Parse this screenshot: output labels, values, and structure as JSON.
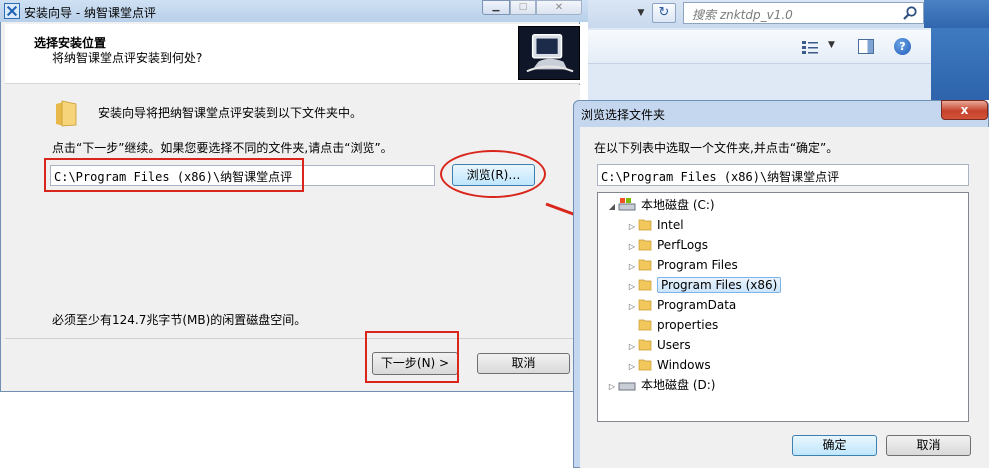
{
  "explorer": {
    "search_placeholder": "搜索 znktdp_v1.0",
    "icons": [
      "chevron-down-icon",
      "refresh-icon",
      "search-icon",
      "view-options-icon",
      "preview-pane-icon",
      "help-icon"
    ]
  },
  "installer": {
    "title": "安装向导 - 纳智课堂点评",
    "header_title": "选择安装位置",
    "header_subtitle": "将纳智课堂点评安装到何处?",
    "intro": "安装向导将把纳智课堂点评安装到以下文件夹中。",
    "instruction": "点击“下一步”继续。如果您要选择不同的文件夹,请点击“浏览”。",
    "path_value": "C:\\Program Files (x86)\\纳智课堂点评",
    "browse_label": "浏览(R)…",
    "space_note": "必须至少有124.7兆字节(MB)的闲置磁盘空间。",
    "next_label": "下一步(N) >",
    "cancel_label": "取消"
  },
  "browse_dialog": {
    "title": "浏览选择文件夹",
    "close_label": "x",
    "instruction": "在以下列表中选取一个文件夹,并点击“确定”。",
    "path_value": "C:\\Program Files (x86)\\纳智课堂点评",
    "tree": {
      "drive_c": "本地磁盘 (C:)",
      "folders": [
        "Intel",
        "PerfLogs",
        "Program Files",
        "Program Files (x86)",
        "ProgramData",
        "properties",
        "Users",
        "Windows"
      ],
      "selected": "Program Files (x86)",
      "drive_d": "本地磁盘 (D:)"
    },
    "ok_label": "确定",
    "cancel_label": "取消"
  },
  "colors": {
    "annotation_red": "#d9261c",
    "button_focus_blue": "#bee6fd",
    "close_red": "#c7432b"
  }
}
